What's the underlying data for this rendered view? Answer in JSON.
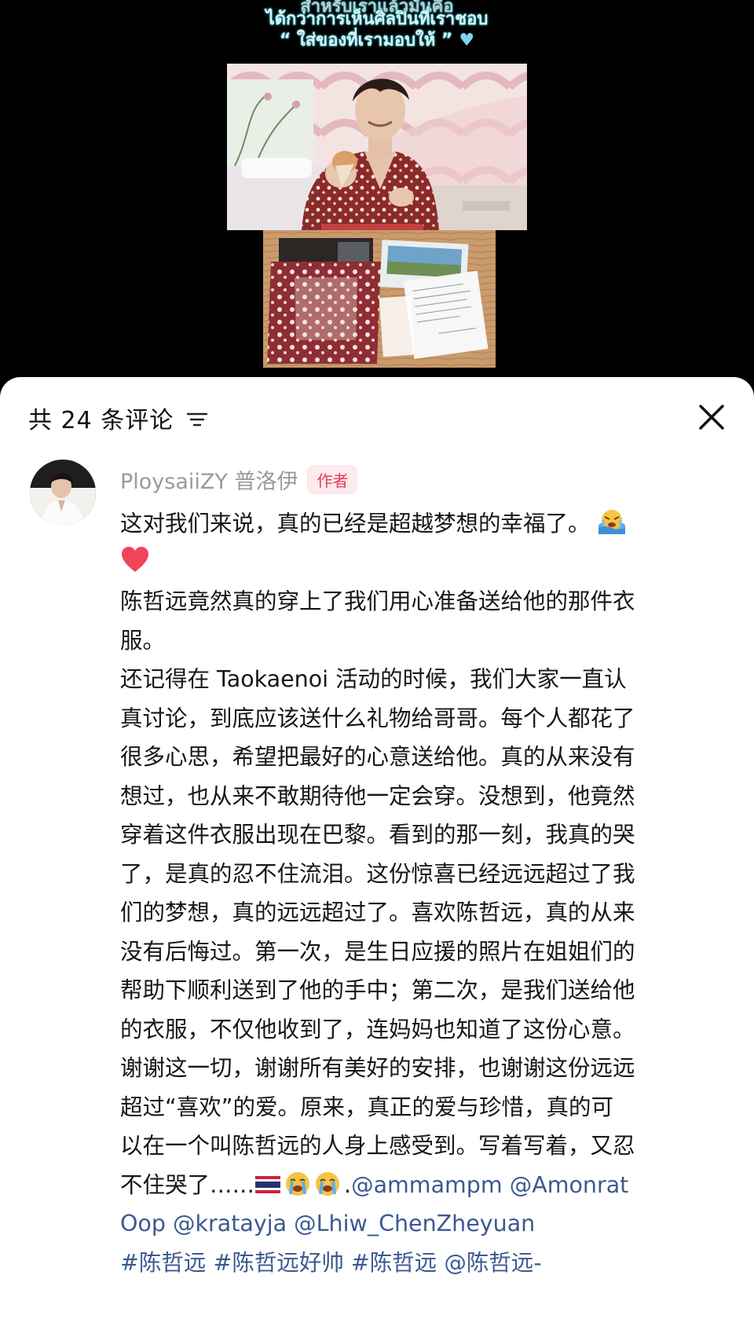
{
  "video": {
    "caption_cut": "สำหรับเราแล้วมันคือ",
    "caption_line1": "ได้กว่าการเห็นศิลปินที่เราชอบ",
    "caption_line2": "“ ใส่ของที่เรามอบให้ ”",
    "heart_icon": "light-blue-heart-icon"
  },
  "comments_panel": {
    "count_label": "共 24 条评论",
    "sort_icon": "sort-icon",
    "close_icon": "close-icon"
  },
  "comment": {
    "author": "PloysaiiZY 普洛伊",
    "badge": "作者",
    "lines": [
      "这对我们来说，真的已经是超越梦想的幸福了。",
      "",
      "陈哲远竟然真的穿上了我们用心准备送给他的那件衣",
      "服。",
      "还记得在 Taokaenoi 活动的时候，我们大家一直认",
      "真讨论，到底应该送什么礼物给哥哥。每个人都花了",
      "很多心思，希望把最好的心意送给他。真的从来没有",
      "想过，也从来不敢期待他一定会穿。没想到，他竟然",
      "穿着这件衣服出现在巴黎。看到的那一刻，我真的哭",
      "了，是真的忍不住流泪。这份惊喜已经远远超过了我",
      "们的梦想，真的远远超过了。喜欢陈哲远，真的从来",
      "没有后悔过。第一次，是生日应援的照片在姐姐们的",
      "帮助下顺利送到了他的手中；第二次，是我们送给他",
      "的衣服，不仅他收到了，连妈妈也知道了这份心意。",
      "谢谢这一切，谢谢所有美好的安排，也谢谢这份远远",
      "超过“喜欢”的爱。原来，真正的爱与珍惜，真的可",
      "以在一个叫陈哲远的人身上感受到。写着写着，又忍"
    ],
    "last_line_text": "不住哭了……",
    "last_line_sep": ".",
    "mention_1": "@ammampm",
    "mention_2": "@Amonrat",
    "mention_2b": "Oop",
    "mention_3": "@kratayja",
    "mention_4": "@Lhiw_ChenZheyuan",
    "hashtag_1": "#陈哲远",
    "hashtag_2": "#陈哲远好帅",
    "hashtag_3": "#陈哲远",
    "mention_5": "@陈哲远-",
    "emojis": [
      "crying-in-water-emoji",
      "red-heart-emoji",
      "thailand-flag-emoji",
      "loudly-crying-face-emoji",
      "loudly-crying-face-emoji"
    ]
  }
}
